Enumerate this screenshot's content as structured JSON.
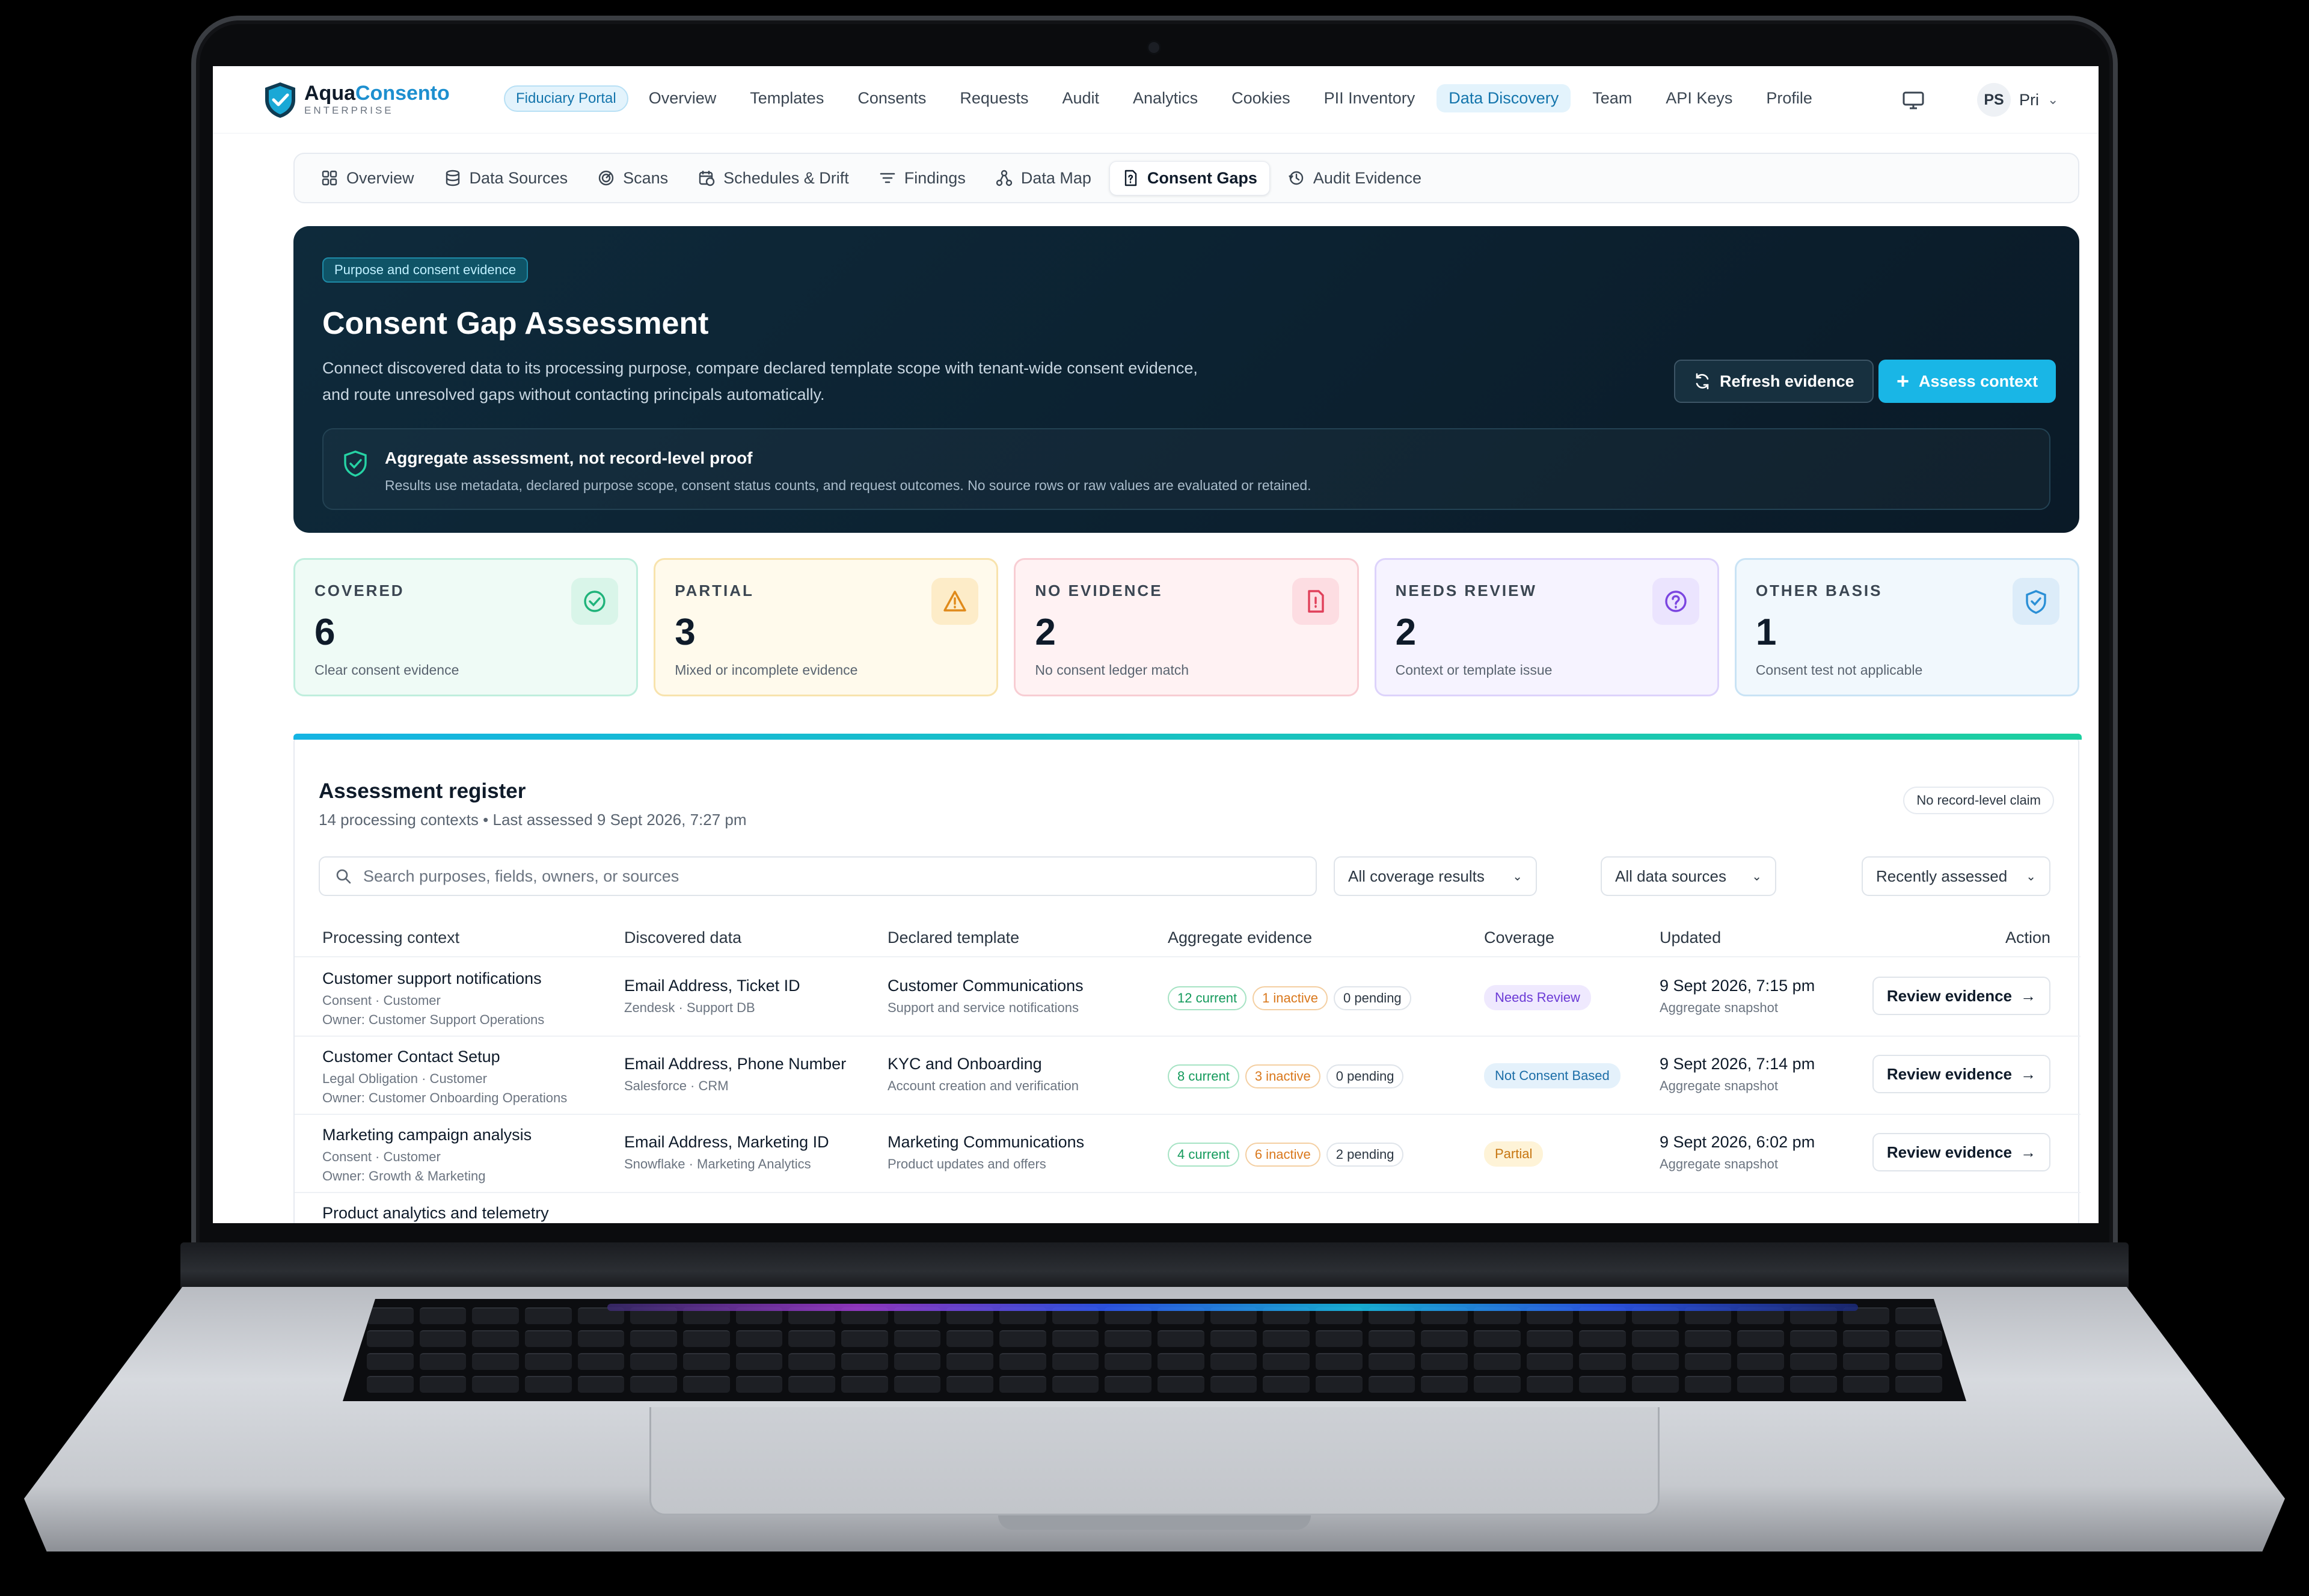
{
  "brand": {
    "name_part1": "Aqua",
    "name_part2": "Consento",
    "edition": "ENTERPRISE"
  },
  "topnav": {
    "portal_badge": "Fiduciary Portal",
    "items": [
      "Overview",
      "Templates",
      "Consents",
      "Requests",
      "Audit",
      "Analytics",
      "Cookies",
      "PII Inventory",
      "Data Discovery",
      "Team",
      "API Keys",
      "Profile"
    ],
    "active": "Data Discovery",
    "user_initials": "PS",
    "user_name": "Pri"
  },
  "subnav": {
    "items": [
      {
        "label": "Overview",
        "icon": "grid-icon"
      },
      {
        "label": "Data Sources",
        "icon": "database-icon"
      },
      {
        "label": "Scans",
        "icon": "radar-icon"
      },
      {
        "label": "Schedules & Drift",
        "icon": "calendar-clock-icon"
      },
      {
        "label": "Findings",
        "icon": "list-filter-icon"
      },
      {
        "label": "Data Map",
        "icon": "network-icon"
      },
      {
        "label": "Consent Gaps",
        "icon": "file-question-icon"
      },
      {
        "label": "Audit Evidence",
        "icon": "audit-icon"
      }
    ],
    "active": "Consent Gaps"
  },
  "hero": {
    "badge": "Purpose and consent evidence",
    "title": "Consent Gap Assessment",
    "description": "Connect discovered data to its processing purpose, compare declared template scope with tenant-wide consent evidence, and route unresolved gaps without contacting principals automatically.",
    "refresh_label": "Refresh evidence",
    "assess_label": "Assess context",
    "note_title": "Aggregate assessment, not record-level proof",
    "note_text": "Results use metadata, declared purpose scope, consent status counts, and request outcomes. No source rows or raw values are evaluated or retained."
  },
  "stats": [
    {
      "label": "COVERED",
      "value": "6",
      "sub": "Clear consent evidence",
      "icon": "check-circle-icon",
      "color": "#1fb37a"
    },
    {
      "label": "PARTIAL",
      "value": "3",
      "sub": "Mixed or incomplete evidence",
      "icon": "warning-triangle-icon",
      "color": "#e08a1a"
    },
    {
      "label": "NO EVIDENCE",
      "value": "2",
      "sub": "No consent ledger match",
      "icon": "file-alert-icon",
      "color": "#e0405a"
    },
    {
      "label": "NEEDS REVIEW",
      "value": "2",
      "sub": "Context or template issue",
      "icon": "help-circle-icon",
      "color": "#7b45e0"
    },
    {
      "label": "OTHER BASIS",
      "value": "1",
      "sub": "Consent test not applicable",
      "icon": "shield-check-icon",
      "color": "#2a8fd6"
    }
  ],
  "register": {
    "title": "Assessment register",
    "subtitle": "14 processing contexts • Last assessed 9 Sept 2026, 7:27 pm",
    "claim_badge": "No record-level claim",
    "search_placeholder": "Search purposes, fields, owners, or sources",
    "filters": [
      "All coverage results",
      "All data sources",
      "Recently assessed"
    ],
    "columns": [
      "Processing context",
      "Discovered data",
      "Declared template",
      "Aggregate evidence",
      "Coverage",
      "Updated",
      "Action"
    ],
    "rows": [
      {
        "context": "Customer support notifications",
        "basis": "Consent · Customer",
        "owner": "Owner: Customer Support Operations",
        "data": "Email Address, Ticket ID",
        "source": "Zendesk · Support DB",
        "template": "Customer Communications",
        "template_sub": "Support and service notifications",
        "current": "12 current",
        "inactive": "1 inactive",
        "pending": "0 pending",
        "coverage": "Needs Review",
        "coverage_kind": "review",
        "updated": "9 Sept 2026, 7:15 pm",
        "updated_sub": "Aggregate snapshot",
        "action": "Review evidence"
      },
      {
        "context": "Customer Contact Setup",
        "basis": "Legal Obligation · Customer",
        "owner": "Owner: Customer Onboarding Operations",
        "data": "Email Address, Phone Number",
        "source": "Salesforce · CRM",
        "template": "KYC and Onboarding",
        "template_sub": "Account creation and verification",
        "current": "8 current",
        "inactive": "3 inactive",
        "pending": "0 pending",
        "coverage": "Not Consent Based",
        "coverage_kind": "notcons",
        "updated": "9 Sept 2026, 7:14 pm",
        "updated_sub": "Aggregate snapshot",
        "action": "Review evidence"
      },
      {
        "context": "Marketing campaign analysis",
        "basis": "Consent · Customer",
        "owner": "Owner: Growth & Marketing",
        "data": "Email Address, Marketing ID",
        "source": "Snowflake · Marketing Analytics",
        "template": "Marketing Communications",
        "template_sub": "Product updates and offers",
        "current": "4 current",
        "inactive": "6 inactive",
        "pending": "2 pending",
        "coverage": "Partial",
        "coverage_kind": "partial",
        "updated": "9 Sept 2026, 6:02 pm",
        "updated_sub": "Aggregate snapshot",
        "action": "Review evidence"
      },
      {
        "context": "Product analytics and telemetry"
      }
    ]
  }
}
